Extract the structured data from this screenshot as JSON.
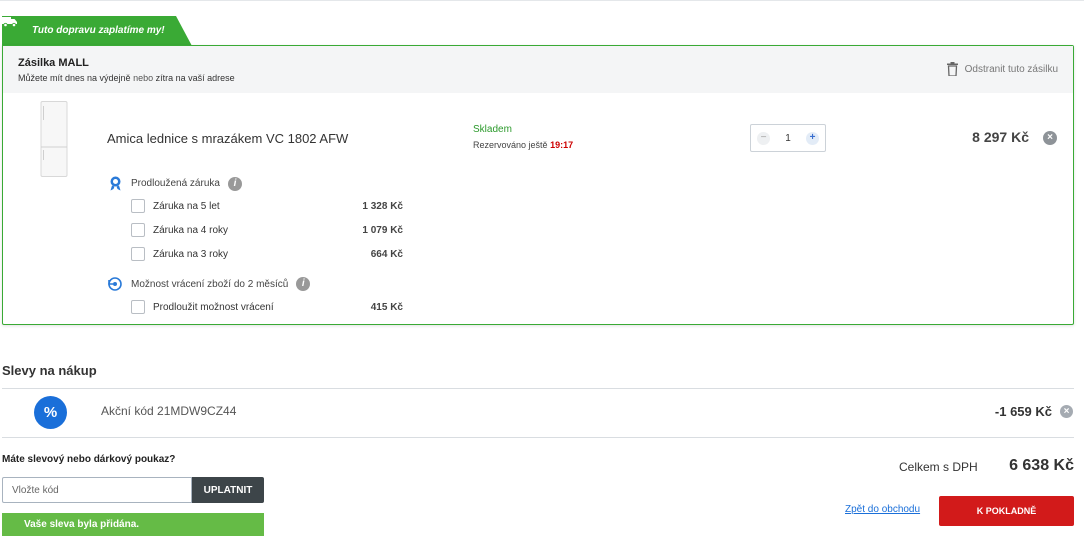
{
  "shipment": {
    "badge": "Tuto dopravu zaplatíme my!",
    "title": "Zásilka MALL",
    "sub_start": "Můžete mít dnes na výdejně",
    "sub_or": "nebo",
    "sub_end": "zítra na vaší adrese",
    "remove_label": "Odstranit tuto zásilku",
    "accent": "#3aaa35"
  },
  "product": {
    "name": "Amica lednice s mrazákem VC 1802 AFW",
    "stock": "Skladem",
    "reserved_label": "Rezervováno ještě",
    "reserved_time": "19:17",
    "quantity": "1",
    "price": "8 297 Kč"
  },
  "warranty": {
    "title": "Prodloužená záruka",
    "options": [
      {
        "label": "Záruka na 5 let",
        "price": "1 328 Kč"
      },
      {
        "label": "Záruka na 4 roky",
        "price": "1 079 Kč"
      },
      {
        "label": "Záruka na 3 roky",
        "price": "664 Kč"
      }
    ]
  },
  "returns": {
    "title": "Možnost vrácení zboží do 2 měsíců",
    "option": {
      "label": "Prodloužit možnost vrácení",
      "price": "415 Kč"
    }
  },
  "discounts": {
    "title": "Slevy na nákup",
    "code_label": "Akční kód 21MDW9CZ44",
    "amount": "-1 659 Kč"
  },
  "voucher": {
    "question": "Máte slevový nebo dárkový poukaz?",
    "placeholder": "Vložte kód",
    "apply_label": "UPLATNIT",
    "success": "Vaše sleva byla přidána."
  },
  "summary": {
    "total_label": "Celkem s DPH",
    "total_value": "6 638 Kč",
    "back_label": "Zpět do obchodu",
    "checkout_label": "K POKLADNĚ"
  }
}
